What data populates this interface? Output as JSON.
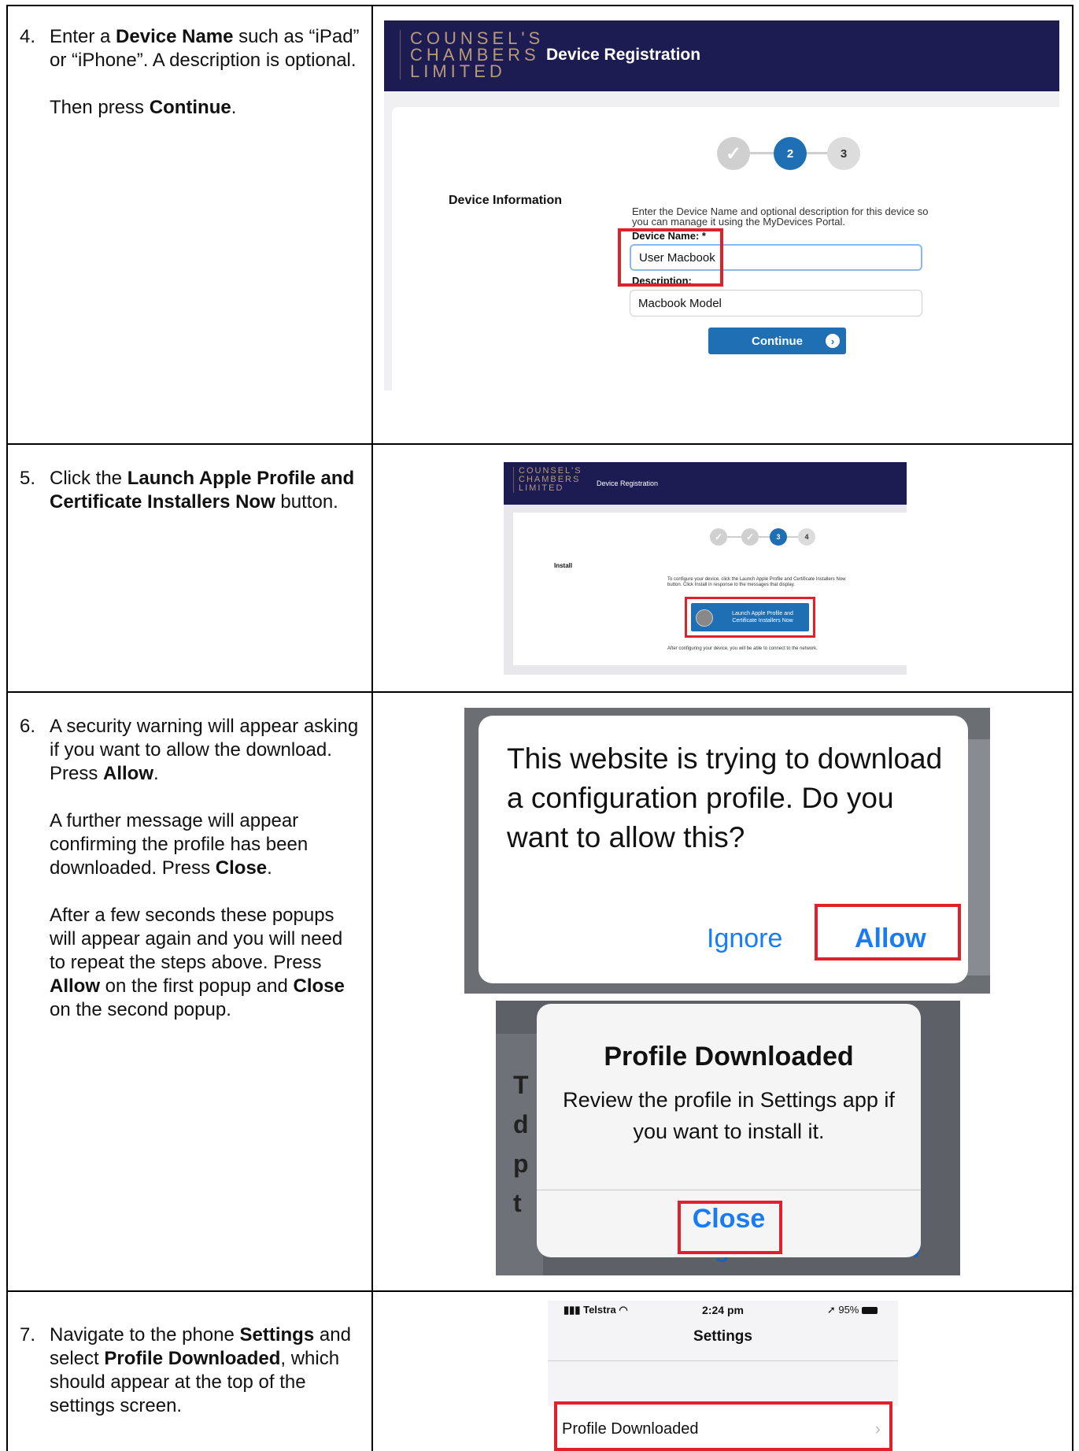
{
  "steps": [
    {
      "num": "4.",
      "paragraphs": [
        [
          {
            "t": "Enter a "
          },
          {
            "t": "Device Name",
            "b": true
          },
          {
            "t": " such as “iPad” or “iPhone”. A description is optional."
          }
        ],
        [
          {
            "t": "Then press "
          },
          {
            "t": "Continue",
            "b": true
          },
          {
            "t": "."
          }
        ]
      ]
    },
    {
      "num": "5.",
      "paragraphs": [
        [
          {
            "t": "Click the "
          },
          {
            "t": "Launch Apple Profile and Certificate Installers Now",
            "b": true
          },
          {
            "t": " button."
          }
        ]
      ]
    },
    {
      "num": "6.",
      "paragraphs": [
        [
          {
            "t": "A security warning will appear asking if you want to allow the download. Press "
          },
          {
            "t": "Allow",
            "b": true
          },
          {
            "t": "."
          }
        ],
        [
          {
            "t": "A further message will appear confirming the profile has been downloaded. Press "
          },
          {
            "t": "Close",
            "b": true
          },
          {
            "t": "."
          }
        ],
        [
          {
            "t": "After a few seconds these popups will appear again and you will need to repeat the steps above. Press "
          },
          {
            "t": "Allow",
            "b": true
          },
          {
            "t": " on the first popup and "
          },
          {
            "t": "Close",
            "b": true
          },
          {
            "t": " on the second popup."
          }
        ]
      ]
    },
    {
      "num": "7.",
      "paragraphs": [
        [
          {
            "t": "Navigate to the phone "
          },
          {
            "t": "Settings",
            "b": true
          },
          {
            "t": " and select "
          },
          {
            "t": "Profile Downloaded",
            "b": true
          },
          {
            "t": ", which should appear at the top of the settings screen."
          }
        ]
      ]
    }
  ],
  "brand": {
    "logo_line1": "COUNSEL'S",
    "logo_line2": "CHAMBERS",
    "logo_line3": "LIMITED",
    "header_title": "Device Registration"
  },
  "shot1": {
    "step_done": "✓",
    "step_current": "2",
    "step_next": "3",
    "section_title": "Device Information",
    "instructions": "Enter the Device Name and optional description for this device so you can manage it using the MyDevices Portal.",
    "device_name_label": "Device Name: *",
    "device_name_value": "User Macbook",
    "description_label": "Description:",
    "description_value": "Macbook Model",
    "continue_label": "Continue"
  },
  "shot2": {
    "step_current": "3",
    "step_next": "4",
    "section_title": "Install",
    "instructions": "To configure your device, click the Launch Apple Profile and Certificate Installers Now button. Click Install in response to the messages that display.",
    "launch_label": "Launch Apple Profile and Certificate Installers Now",
    "after_text": "After configuring your device, you will be able to connect to the network."
  },
  "shot3": {
    "message": "This website is trying to download a configuration profile. Do you want to allow this?",
    "ignore_label": "Ignore",
    "allow_label": "Allow"
  },
  "shot4": {
    "title": "Profile Downloaded",
    "message": "Review the profile in Settings app if you want to install it.",
    "close_label": "Close",
    "bg_ignore": "Ignore",
    "bg_allow": "Allow"
  },
  "shot5": {
    "carrier": "Telstra",
    "time": "2:24 pm",
    "battery": "95%",
    "title": "Settings",
    "row_label": "Profile Downloaded"
  },
  "colors": {
    "header_bg": "#1c1c52",
    "accent_blue": "#1f6fb5",
    "highlight_red": "#e0202a",
    "ios_blue": "#1a7cf5"
  }
}
